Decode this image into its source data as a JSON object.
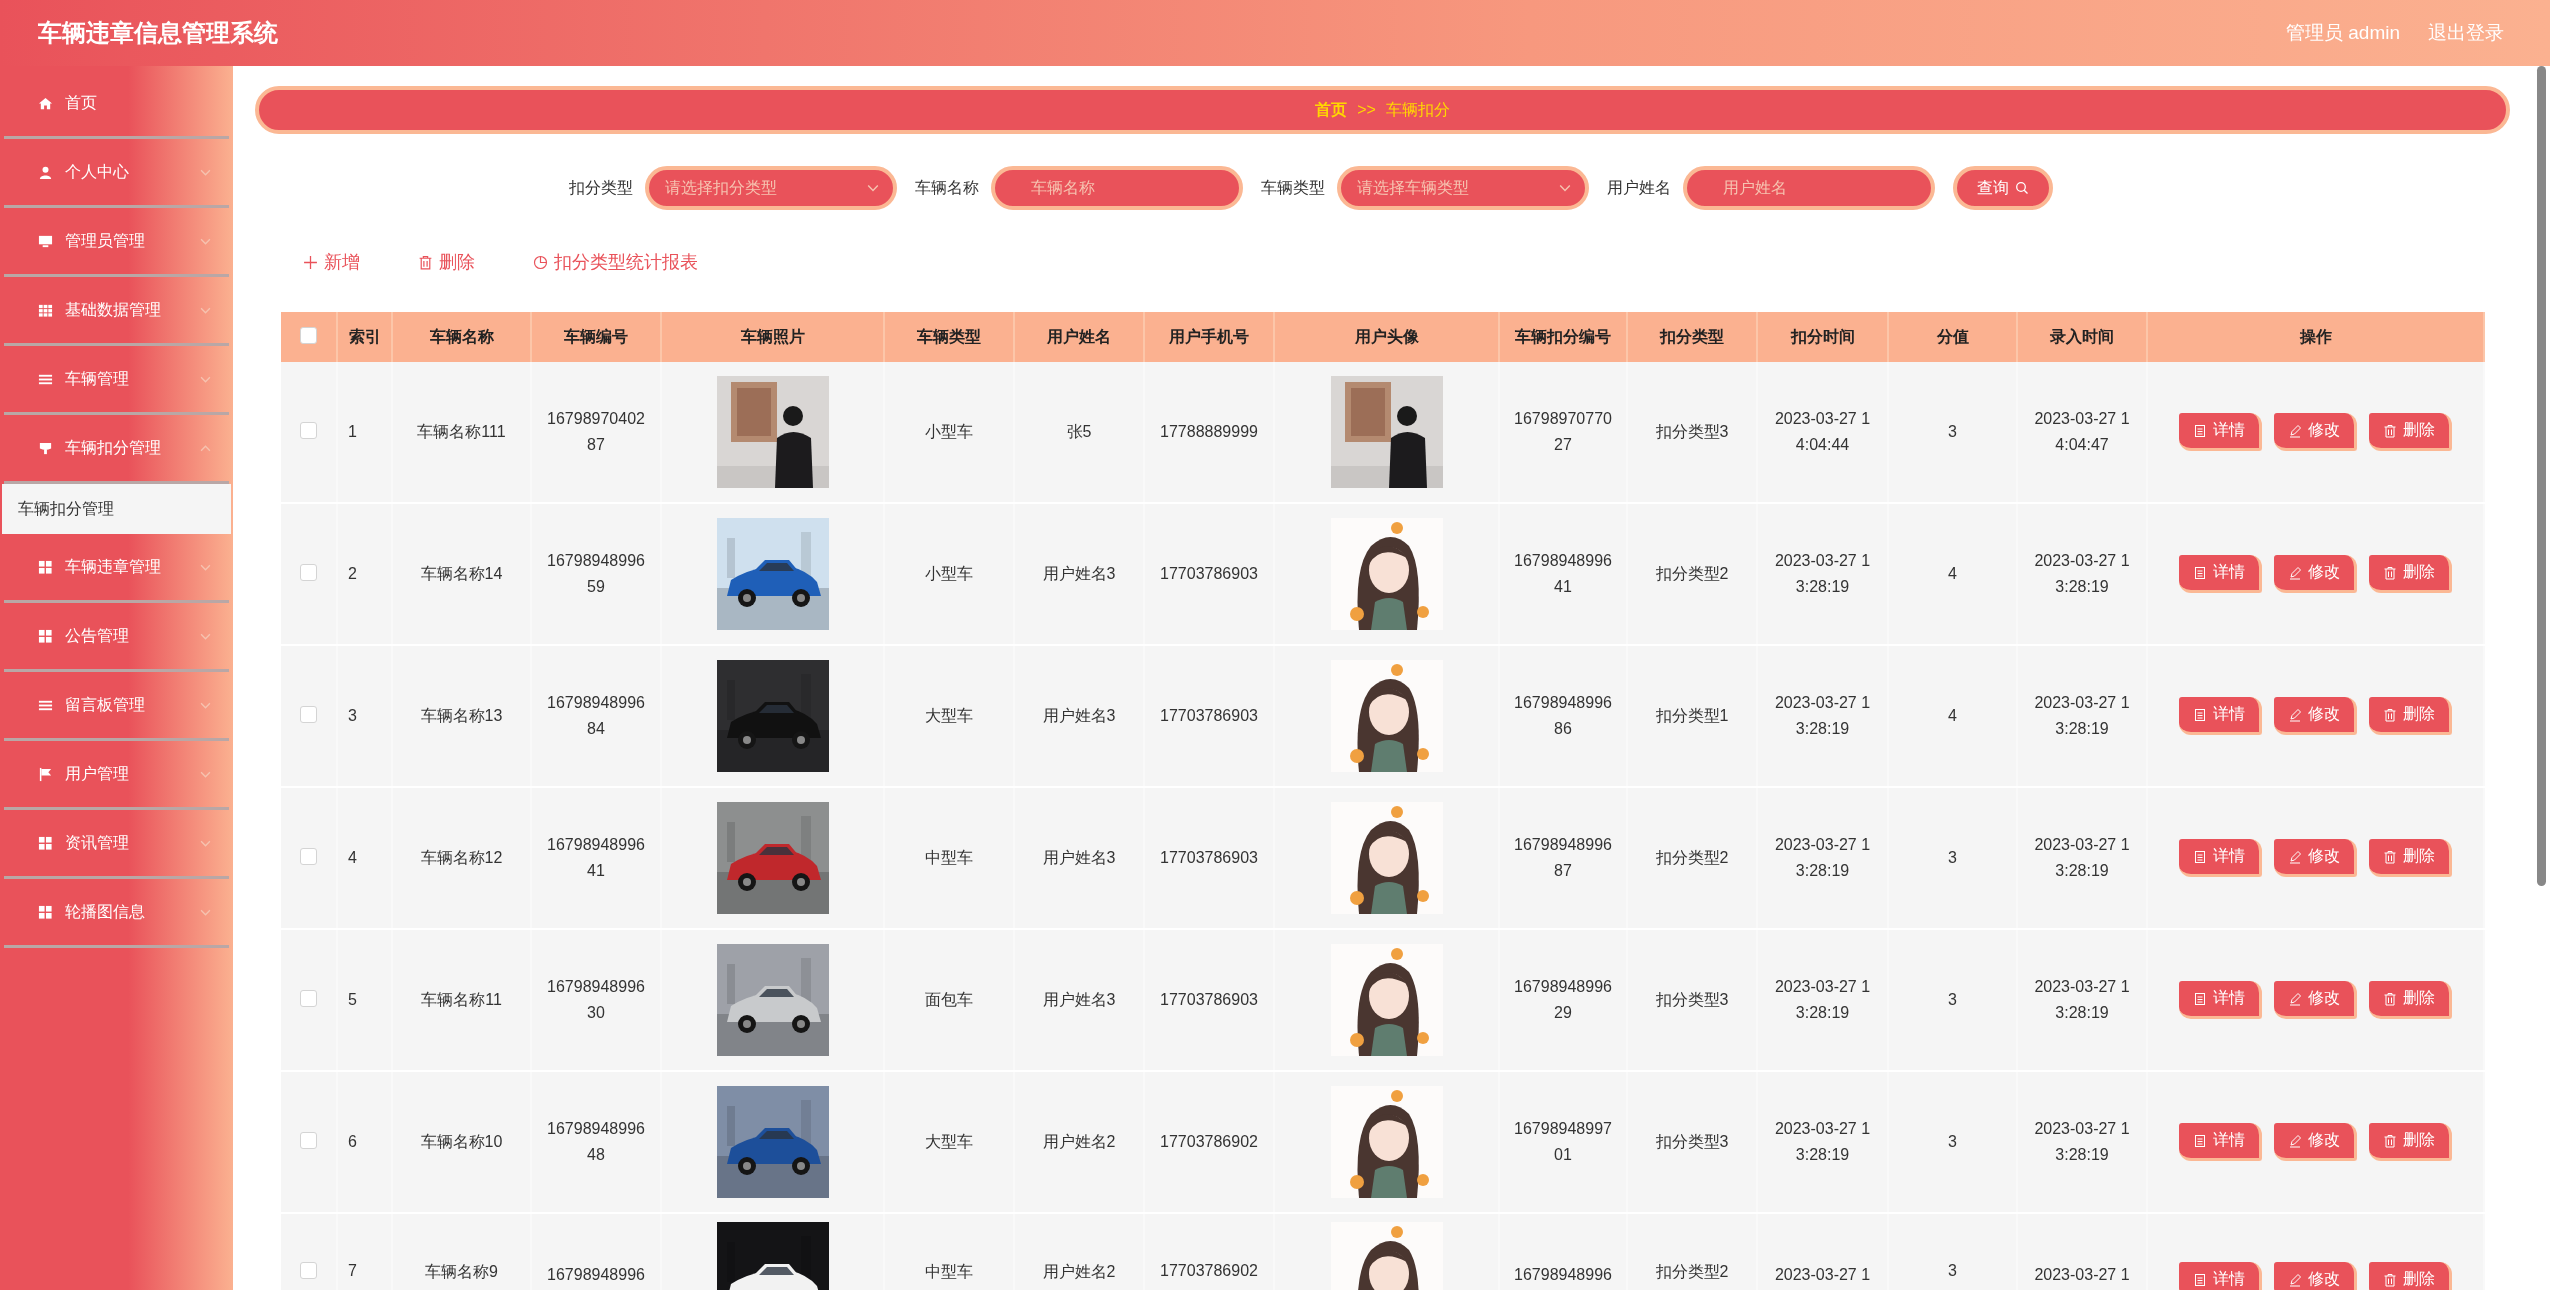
{
  "header": {
    "title": "车辆违章信息管理系统",
    "user": "管理员 admin",
    "logout": "退出登录"
  },
  "sidebar": {
    "items": [
      {
        "label": "首页"
      },
      {
        "label": "个人中心",
        "expanded": false
      },
      {
        "label": "管理员管理",
        "expanded": false
      },
      {
        "label": "基础数据管理",
        "expanded": false
      },
      {
        "label": "车辆管理",
        "expanded": false
      },
      {
        "label": "车辆扣分管理",
        "expanded": true,
        "children": [
          {
            "label": "车辆扣分管理",
            "selected": true
          }
        ]
      },
      {
        "label": "车辆违章管理",
        "expanded": false
      },
      {
        "label": "公告管理",
        "expanded": false
      },
      {
        "label": "留言板管理",
        "expanded": false
      },
      {
        "label": "用户管理",
        "expanded": false
      },
      {
        "label": "资讯管理",
        "expanded": false
      },
      {
        "label": "轮播图信息",
        "expanded": false
      }
    ]
  },
  "breadcrumb": {
    "home": "首页",
    "separator": ">>",
    "current": "车辆扣分"
  },
  "search": {
    "fields": [
      {
        "kind": "select",
        "label": "扣分类型",
        "placeholder": "请选择扣分类型"
      },
      {
        "kind": "input",
        "label": "车辆名称",
        "placeholder": "车辆名称"
      },
      {
        "kind": "select",
        "label": "车辆类型",
        "placeholder": "请选择车辆类型"
      },
      {
        "kind": "input",
        "label": "用户姓名",
        "placeholder": "用户姓名"
      }
    ],
    "button": "查询"
  },
  "actions": [
    {
      "kind": "add",
      "label": "新增"
    },
    {
      "kind": "delete",
      "label": "删除"
    },
    {
      "kind": "report",
      "label": "扣分类型统计报表"
    }
  ],
  "table": {
    "select_all": false,
    "columns": [
      "索引",
      "车辆名称",
      "车辆编号",
      "车辆照片",
      "车辆类型",
      "用户姓名",
      "用户手机号",
      "用户头像",
      "车辆扣分编号",
      "扣分类型",
      "扣分时间",
      "分值",
      "录入时间",
      "操作"
    ],
    "rows": [
      {
        "checked": false,
        "index": "1",
        "name": "车辆名称111",
        "code": "1679897040287",
        "type": "小型车",
        "user": "张5",
        "phone": "17788889999",
        "deduct_code": "1679897077027",
        "deduct_type": "扣分类型3",
        "deduct_time": "2023-03-27 14:04:44",
        "score": "3",
        "created": "2023-03-27 14:04:47",
        "buttons": [
          "详情",
          "修改",
          "删除"
        ]
      },
      {
        "checked": false,
        "index": "2",
        "name": "车辆名称14",
        "code": "1679894899659",
        "type": "小型车",
        "user": "用户姓名3",
        "phone": "17703786903",
        "deduct_code": "1679894899641",
        "deduct_type": "扣分类型2",
        "deduct_time": "2023-03-27 13:28:19",
        "score": "4",
        "created": "2023-03-27 13:28:19",
        "buttons": [
          "详情",
          "修改",
          "删除"
        ]
      },
      {
        "checked": false,
        "index": "3",
        "name": "车辆名称13",
        "code": "1679894899684",
        "type": "大型车",
        "user": "用户姓名3",
        "phone": "17703786903",
        "deduct_code": "1679894899686",
        "deduct_type": "扣分类型1",
        "deduct_time": "2023-03-27 13:28:19",
        "score": "4",
        "created": "2023-03-27 13:28:19",
        "buttons": [
          "详情",
          "修改",
          "删除"
        ]
      },
      {
        "checked": false,
        "index": "4",
        "name": "车辆名称12",
        "code": "1679894899641",
        "type": "中型车",
        "user": "用户姓名3",
        "phone": "17703786903",
        "deduct_code": "1679894899687",
        "deduct_type": "扣分类型2",
        "deduct_time": "2023-03-27 13:28:19",
        "score": "3",
        "created": "2023-03-27 13:28:19",
        "buttons": [
          "详情",
          "修改",
          "删除"
        ]
      },
      {
        "checked": false,
        "index": "5",
        "name": "车辆名称11",
        "code": "1679894899630",
        "type": "面包车",
        "user": "用户姓名3",
        "phone": "17703786903",
        "deduct_code": "1679894899629",
        "deduct_type": "扣分类型3",
        "deduct_time": "2023-03-27 13:28:19",
        "score": "3",
        "created": "2023-03-27 13:28:19",
        "buttons": [
          "详情",
          "修改",
          "删除"
        ]
      },
      {
        "checked": false,
        "index": "6",
        "name": "车辆名称10",
        "code": "1679894899648",
        "type": "大型车",
        "user": "用户姓名2",
        "phone": "17703786902",
        "deduct_code": "1679894899701",
        "deduct_type": "扣分类型3",
        "deduct_time": "2023-03-27 13:28:19",
        "score": "3",
        "created": "2023-03-27 13:28:19",
        "buttons": [
          "详情",
          "修改",
          "删除"
        ]
      },
      {
        "checked": false,
        "index": "7",
        "name": "车辆名称9",
        "code": "16798948996",
        "type": "中型车",
        "user": "用户姓名2",
        "phone": "17703786902",
        "deduct_code": "16798948996",
        "deduct_type": "扣分类型2",
        "deduct_time": "2023-03-27 1",
        "score": "3",
        "created": "2023-03-27 1",
        "buttons": [
          "详情",
          "修改",
          "删除"
        ]
      }
    ]
  }
}
